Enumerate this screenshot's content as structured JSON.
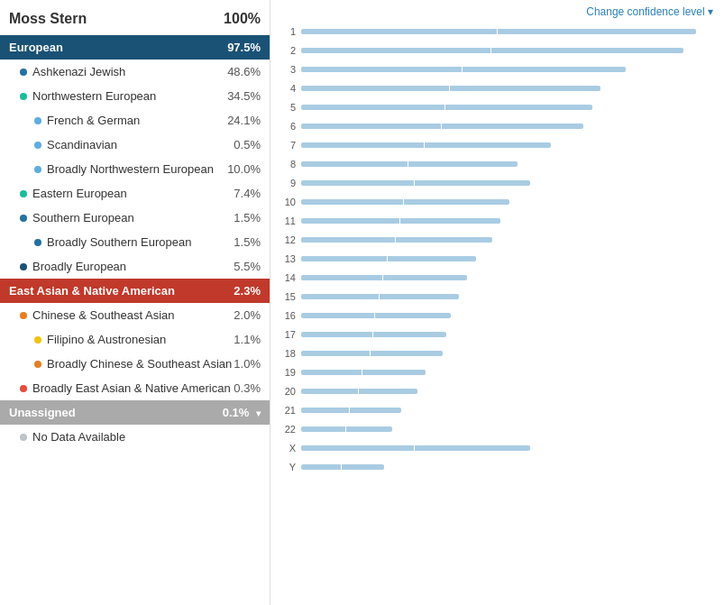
{
  "header": {
    "name": "Moss Stern",
    "total": "100%",
    "change_confidence": "Change confidence level ▾"
  },
  "categories": [
    {
      "id": "european",
      "label": "European",
      "pct": "97.5%",
      "type": "header",
      "color": "blue"
    },
    {
      "id": "ashkenazi",
      "label": "Ashkenazi Jewish",
      "pct": "48.6%",
      "type": "sub",
      "dot": "#2471a3"
    },
    {
      "id": "northwestern",
      "label": "Northwestern European",
      "pct": "34.5%",
      "type": "sub",
      "dot": "#1abc9c"
    },
    {
      "id": "french-german",
      "label": "French & German",
      "pct": "24.1%",
      "type": "subsub",
      "dot": "#5dade2"
    },
    {
      "id": "scandinavian",
      "label": "Scandinavian",
      "pct": "0.5%",
      "type": "subsub",
      "dot": "#5dade2"
    },
    {
      "id": "broadly-nw",
      "label": "Broadly Northwestern European",
      "pct": "10.0%",
      "type": "subsub",
      "dot": "#5dade2"
    },
    {
      "id": "eastern",
      "label": "Eastern European",
      "pct": "7.4%",
      "type": "sub",
      "dot": "#1abc9c"
    },
    {
      "id": "southern",
      "label": "Southern European",
      "pct": "1.5%",
      "type": "sub",
      "dot": "#2471a3"
    },
    {
      "id": "broadly-south",
      "label": "Broadly Southern European",
      "pct": "1.5%",
      "type": "subsub",
      "dot": "#2471a3"
    },
    {
      "id": "broadly-eu",
      "label": "Broadly European",
      "pct": "5.5%",
      "type": "sub",
      "dot": "#1a5276"
    },
    {
      "id": "east-asian",
      "label": "East Asian & Native American",
      "pct": "2.3%",
      "type": "header",
      "color": "red"
    },
    {
      "id": "chinese-se",
      "label": "Chinese & Southeast Asian",
      "pct": "2.0%",
      "type": "sub",
      "dot": "#e67e22"
    },
    {
      "id": "filipino",
      "label": "Filipino & Austronesian",
      "pct": "1.1%",
      "type": "subsub",
      "dot": "#f1c40f"
    },
    {
      "id": "broadly-chinese",
      "label": "Broadly Chinese & Southeast Asian",
      "pct": "1.0%",
      "type": "subsub",
      "dot": "#e67e22"
    },
    {
      "id": "broadly-east",
      "label": "Broadly East Asian & Native American",
      "pct": "0.3%",
      "type": "sub",
      "dot": "#e74c3c"
    },
    {
      "id": "unassigned",
      "label": "Unassigned",
      "pct": "0.1%",
      "type": "header",
      "color": "gray"
    },
    {
      "id": "no-data",
      "label": "No Data Available",
      "pct": "",
      "type": "sub",
      "dot": "#bdc3c7"
    }
  ],
  "chromosomes": [
    {
      "id": "1",
      "label": "1",
      "bars": [
        {
          "color": "c-ltblue",
          "w": 5
        },
        {
          "color": "c-teal",
          "w": 30
        },
        {
          "color": "c-ltblue",
          "w": 8
        },
        {
          "color": "c-teal",
          "w": 12
        },
        {
          "color": "c-orange",
          "w": 4
        },
        {
          "color": "c-teal",
          "w": 18
        },
        {
          "color": "c-ltblue",
          "w": 6
        }
      ],
      "range": 95
    },
    {
      "id": "2",
      "label": "2",
      "bars": [
        {
          "color": "c-teal",
          "w": 20
        },
        {
          "color": "c-ltblue",
          "w": 5
        },
        {
          "color": "c-teal",
          "w": 35
        },
        {
          "color": "c-ltblue",
          "w": 10
        },
        {
          "color": "c-teal",
          "w": 18
        }
      ],
      "range": 92
    },
    {
      "id": "3",
      "label": "3",
      "bars": [
        {
          "color": "c-teal",
          "w": 60
        },
        {
          "color": "c-ltblue",
          "w": 10
        }
      ],
      "range": 78
    },
    {
      "id": "4",
      "label": "4",
      "bars": [
        {
          "color": "c-ltblue",
          "w": 6
        },
        {
          "color": "c-teal",
          "w": 18
        },
        {
          "color": "c-ltblue",
          "w": 5
        },
        {
          "color": "c-orange",
          "w": 5
        },
        {
          "color": "c-teal",
          "w": 10
        },
        {
          "color": "c-blue",
          "w": 8
        },
        {
          "color": "c-dkblue",
          "w": 4
        }
      ],
      "range": 72
    },
    {
      "id": "5",
      "label": "5",
      "bars": [
        {
          "color": "c-blue",
          "w": 8
        },
        {
          "color": "c-teal",
          "w": 18
        },
        {
          "color": "c-ltblue",
          "w": 5
        },
        {
          "color": "c-teal",
          "w": 22
        },
        {
          "color": "c-ltblue",
          "w": 5
        }
      ],
      "range": 70
    },
    {
      "id": "6",
      "label": "6",
      "bars": [
        {
          "color": "c-teal",
          "w": 25
        },
        {
          "color": "c-ltblue",
          "w": 5
        },
        {
          "color": "c-teal",
          "w": 20
        },
        {
          "color": "c-ltblue",
          "w": 6
        }
      ],
      "range": 68
    },
    {
      "id": "7",
      "label": "7",
      "bars": [
        {
          "color": "c-teal",
          "w": 40
        },
        {
          "color": "c-ltblue",
          "w": 6
        }
      ],
      "range": 60
    },
    {
      "id": "8",
      "label": "8",
      "bars": [
        {
          "color": "c-teal",
          "w": 38
        },
        {
          "color": "c-ltblue",
          "w": 5
        }
      ],
      "range": 52
    },
    {
      "id": "9",
      "label": "9",
      "bars": [
        {
          "color": "c-dkblue",
          "w": 4
        },
        {
          "color": "c-blue",
          "w": 4
        },
        {
          "color": "c-ltblue",
          "w": 5
        },
        {
          "color": "c-teal",
          "w": 28
        },
        {
          "color": "c-ltblue",
          "w": 5
        }
      ],
      "range": 55
    },
    {
      "id": "10",
      "label": "10",
      "bars": [
        {
          "color": "c-teal",
          "w": 25
        },
        {
          "color": "c-ltblue",
          "w": 8
        },
        {
          "color": "c-teal",
          "w": 6
        }
      ],
      "range": 50
    },
    {
      "id": "11",
      "label": "11",
      "bars": [
        {
          "color": "c-teal",
          "w": 20
        },
        {
          "color": "c-ltblue",
          "w": 5
        },
        {
          "color": "c-blue",
          "w": 4
        },
        {
          "color": "c-dkblue",
          "w": 5
        },
        {
          "color": "c-ltblue",
          "w": 5
        }
      ],
      "range": 48
    },
    {
      "id": "12",
      "label": "12",
      "bars": [
        {
          "color": "c-ltblue",
          "w": 4
        },
        {
          "color": "c-teal",
          "w": 8
        },
        {
          "color": "c-yellow",
          "w": 3
        },
        {
          "color": "c-orange",
          "w": 4
        },
        {
          "color": "c-red",
          "w": 4
        },
        {
          "color": "c-blue",
          "w": 4
        },
        {
          "color": "c-dkblue",
          "w": 5
        }
      ],
      "range": 46
    },
    {
      "id": "13",
      "label": "13",
      "bars": [
        {
          "color": "c-ltgray",
          "w": 5
        },
        {
          "color": "c-teal",
          "w": 20
        },
        {
          "color": "c-blue",
          "w": 5
        },
        {
          "color": "c-ltblue",
          "w": 5
        }
      ],
      "range": 42
    },
    {
      "id": "14",
      "label": "14",
      "bars": [
        {
          "color": "c-ltgray",
          "w": 5
        },
        {
          "color": "c-teal",
          "w": 18
        },
        {
          "color": "c-blue",
          "w": 5
        }
      ],
      "range": 40
    },
    {
      "id": "15",
      "label": "15",
      "bars": [
        {
          "color": "c-ltgray",
          "w": 4
        },
        {
          "color": "c-dkblue",
          "w": 8
        },
        {
          "color": "c-teal",
          "w": 10
        },
        {
          "color": "c-yellow",
          "w": 4
        },
        {
          "color": "c-ltblue",
          "w": 3
        }
      ],
      "range": 38
    },
    {
      "id": "16",
      "label": "16",
      "bars": [
        {
          "color": "c-yellow",
          "w": 3
        },
        {
          "color": "c-orange",
          "w": 3
        },
        {
          "color": "c-ltblue",
          "w": 3
        },
        {
          "color": "c-teal",
          "w": 10
        },
        {
          "color": "c-ltblue",
          "w": 5
        }
      ],
      "range": 36
    },
    {
      "id": "17",
      "label": "17",
      "bars": [
        {
          "color": "c-blue",
          "w": 4
        },
        {
          "color": "c-ltblue",
          "w": 4
        },
        {
          "color": "c-teal",
          "w": 18
        },
        {
          "color": "c-ltblue",
          "w": 4
        }
      ],
      "range": 35
    },
    {
      "id": "18",
      "label": "18",
      "bars": [
        {
          "color": "c-teal",
          "w": 22
        },
        {
          "color": "c-ltblue",
          "w": 4
        }
      ],
      "range": 34
    },
    {
      "id": "19",
      "label": "19",
      "bars": [
        {
          "color": "c-teal",
          "w": 18
        },
        {
          "color": "c-ltblue",
          "w": 4
        }
      ],
      "range": 30
    },
    {
      "id": "20",
      "label": "20",
      "bars": [
        {
          "color": "c-blue",
          "w": 4
        },
        {
          "color": "c-yellow",
          "w": 3
        },
        {
          "color": "c-orange",
          "w": 3
        },
        {
          "color": "c-teal",
          "w": 10
        }
      ],
      "range": 28
    },
    {
      "id": "21",
      "label": "21",
      "bars": [
        {
          "color": "c-ltgray",
          "w": 4
        },
        {
          "color": "c-blue",
          "w": 4
        },
        {
          "color": "c-yellow",
          "w": 3
        },
        {
          "color": "c-teal",
          "w": 8
        }
      ],
      "range": 24
    },
    {
      "id": "22",
      "label": "22",
      "bars": [
        {
          "color": "c-ltgray",
          "w": 4
        },
        {
          "color": "c-teal",
          "w": 12
        }
      ],
      "range": 22
    },
    {
      "id": "X",
      "label": "X",
      "bars": [
        {
          "color": "c-teal",
          "w": 20
        },
        {
          "color": "c-ltblue",
          "w": 5
        },
        {
          "color": "c-teal",
          "w": 15
        },
        {
          "color": "c-ltblue",
          "w": 4
        }
      ],
      "range": 55
    },
    {
      "id": "Y",
      "label": "Y",
      "bars": [
        {
          "color": "c-ltgray",
          "w": 20
        }
      ],
      "range": 20
    }
  ]
}
